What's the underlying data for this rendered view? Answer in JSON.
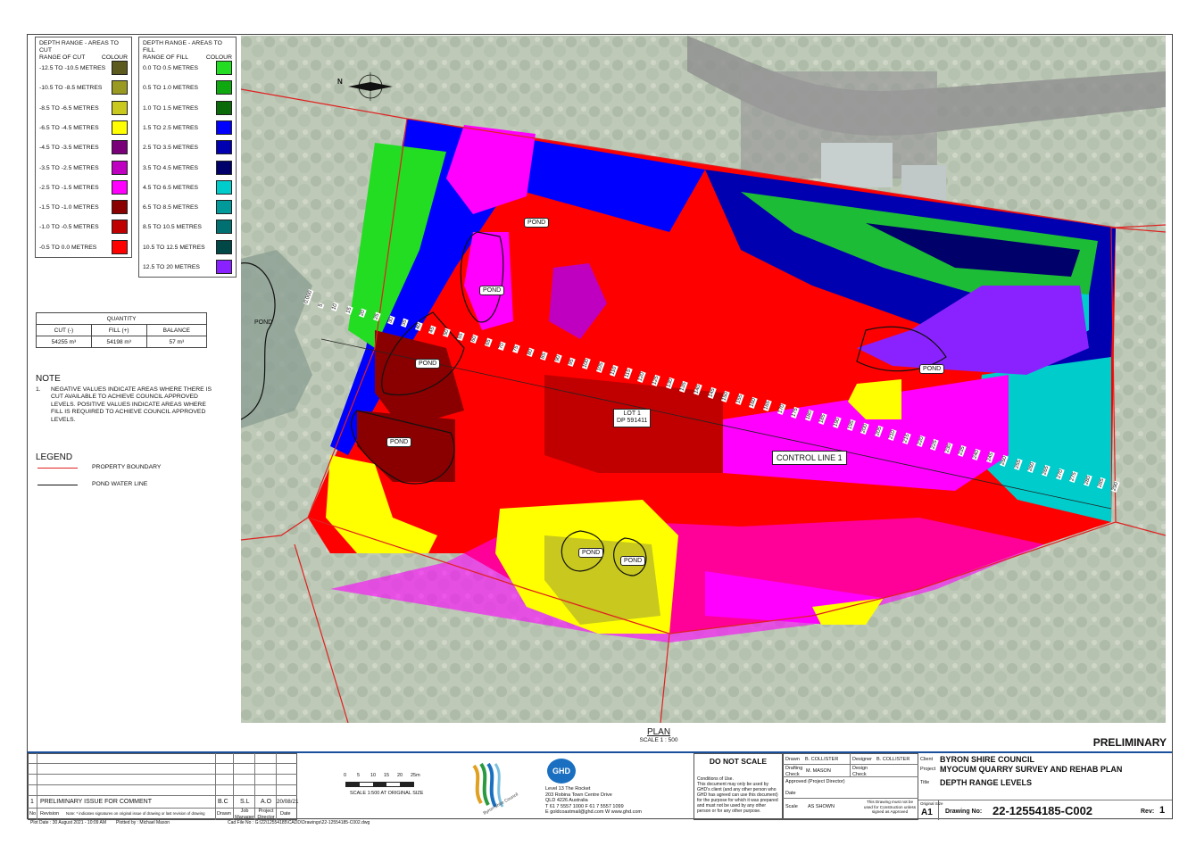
{
  "cut_legend": {
    "title": "DEPTH RANGE - AREAS TO CUT",
    "col1": "RANGE OF CUT",
    "col2": "COLOUR",
    "rows": [
      {
        "label": "-12.5  TO  -10.5  METRES",
        "color": "#5c5a1c"
      },
      {
        "label": "-10.5  TO   -8.5  METRES",
        "color": "#9a9a22"
      },
      {
        "label": "-8.5   TO   -6.5  METRES",
        "color": "#c8c81e"
      },
      {
        "label": "-6.5   TO   -4.5  METRES",
        "color": "#ffff00"
      },
      {
        "label": "-4.5   TO   -3.5  METRES",
        "color": "#7a007a"
      },
      {
        "label": "-3.5   TO   -2.5  METRES",
        "color": "#c000c0"
      },
      {
        "label": "-2.5   TO   -1.5  METRES",
        "color": "#ff00ff"
      },
      {
        "label": "-1.5   TO   -1.0  METRES",
        "color": "#8a0000"
      },
      {
        "label": "-1.0   TO   -0.5  METRES",
        "color": "#c00000"
      },
      {
        "label": "-0.5   TO    0.0  METRES",
        "color": "#ff0000"
      }
    ]
  },
  "fill_legend": {
    "title": "DEPTH RANGE - AREAS TO FILL",
    "col1": "RANGE OF FILL",
    "col2": "COLOUR",
    "rows": [
      {
        "label": "0.0    TO   0.5   METRES",
        "color": "#22dd22"
      },
      {
        "label": "0.5    TO   1.0   METRES",
        "color": "#10a810"
      },
      {
        "label": "1.0    TO   1.5   METRES",
        "color": "#0a6a0a"
      },
      {
        "label": "1.5    TO   2.5   METRES",
        "color": "#0000ff"
      },
      {
        "label": "2.5    TO   3.5   METRES",
        "color": "#0000b0"
      },
      {
        "label": "3.5    TO   4.5   METRES",
        "color": "#00006a"
      },
      {
        "label": "4.5    TO   6.5   METRES",
        "color": "#00cccc"
      },
      {
        "label": "6.5    TO   8.5   METRES",
        "color": "#009a9a"
      },
      {
        "label": "8.5    TO   10.5  METRES",
        "color": "#007070"
      },
      {
        "label": "10.5   TO   12.5  METRES",
        "color": "#004848"
      },
      {
        "label": "12.5   TO   20    METRES",
        "color": "#8a22ff"
      }
    ]
  },
  "quantity": {
    "title": "QUANTITY",
    "headers": [
      "CUT (-)",
      "FILL (+)",
      "BALANCE"
    ],
    "values": [
      "54255 m³",
      "54198 m³",
      "57 m³"
    ]
  },
  "note": {
    "title": "NOTE",
    "number": "1.",
    "text": "NEGATIVE VALUES INDICATE AREAS WHERE THERE IS CUT AVAILABLE TO ACHIEVE COUNCIL APPROVED LEVELS. POSITIVE VALUES INDICATE AREAS WHERE FILL IS REQUIRED TO ACHIEVE COUNCIL APPROVED LEVELS."
  },
  "legend": {
    "title": "LEGEND",
    "items": [
      {
        "label": "PROPERTY BOUNDARY",
        "color": "#e02020"
      },
      {
        "label": "POND WATER LINE",
        "color": "#111111"
      }
    ]
  },
  "map": {
    "north_label": "N",
    "pond_label": "POND",
    "lot_label": "LOT 1",
    "dp_label": "DP 591411",
    "control_line_label": "CONTROL LINE 1",
    "chainages": [
      "0.000",
      "5",
      "10",
      "15",
      "20",
      "25",
      "30",
      "35",
      "40",
      "45",
      "50",
      "55",
      "60",
      "65",
      "70",
      "75",
      "80",
      "85",
      "90",
      "95",
      "100",
      "105",
      "110",
      "115",
      "120",
      "125",
      "130",
      "135",
      "140",
      "145",
      "150",
      "155",
      "160",
      "165",
      "170",
      "175",
      "180",
      "185",
      "190",
      "195",
      "200",
      "205",
      "210",
      "215",
      "220",
      "225",
      "230",
      "235",
      "240",
      "245",
      "250",
      "255",
      "260",
      "265",
      "270",
      "275",
      "280",
      "285",
      "290"
    ]
  },
  "plan": {
    "title": "PLAN",
    "scale": "SCALE 1 : 500"
  },
  "preliminary": "PRELIMINARY",
  "revision_table": {
    "rows": [
      {
        "no": "1",
        "revision": "PRELIMINARY ISSUE FOR COMMENT",
        "drawn": "B.C",
        "job_manager": "S.L",
        "project_director": "A.O",
        "date": "20/08/21"
      }
    ],
    "headers": {
      "no": "No",
      "revision": "Revision",
      "note": "Note: * indicates signatures on original issue of drawing or last revision of drawing",
      "drawn": "Drawn",
      "job_manager": "Job Manager",
      "project_director": "Project Director",
      "date": "Date"
    }
  },
  "scale_bar": {
    "ticks": [
      "0",
      "5",
      "10",
      "15",
      "20",
      "25m"
    ],
    "caption": "SCALE 1:500  AT ORIGINAL SIZE"
  },
  "ghd": {
    "logo": "GHD",
    "address": [
      "Level 13 The Rocket",
      "203 Robina Town Centre Drive",
      "QLD 4226 Australia"
    ],
    "phone": "T 61 7 5557 1000  F 61 7 5557 1099",
    "email": "E goldcoastmail@ghd.com  W www.ghd.com"
  },
  "council_logo_text": "Byron Shire Council",
  "conditions": {
    "do_not_scale": "DO NOT SCALE",
    "title": "Conditions of Use.",
    "text": "This document may only be used by GHD's client (and any other person who GHD has agreed can use this document) for the purpose for which it was prepared and must not be used by any other person or for any other purpose."
  },
  "signoff": {
    "drawn_label": "Drawn",
    "drawn": "B. COLLISTER",
    "designer_label": "Designer",
    "designer": "B. COLLISTER",
    "drafting_label": "Drafting Check",
    "drafting": "M. MASON",
    "design_check_label": "Design Check",
    "approved_label": "Approved (Project Director)",
    "date_label": "Date",
    "scale_label": "Scale",
    "scale": "AS SHOWN",
    "construction_note": "This Drawing must not be used for Construction unless signed as Approved"
  },
  "title_info": {
    "client_label": "Client",
    "client": "BYRON SHIRE COUNCIL",
    "project_label": "Project",
    "project": "MYOCUM QUARRY SURVEY AND REHAB PLAN",
    "title_label": "Title",
    "title": "DEPTH RANGE LEVELS",
    "size_label": "Original Size",
    "size": "A1",
    "drawing_no_label": "Drawing No:",
    "drawing_no": "22-12554185-C002",
    "rev_label": "Rev:",
    "rev": "1"
  },
  "footer": {
    "plot_date": "Plot Date :  30 August 2021 - 10:09 AM",
    "plotted_by": "Plotted by :   Michael Mason",
    "cad_file": "Cad File No :   G:\\22\\12554185\\CADD\\Drawings\\22-12554185-C002.dwg"
  }
}
